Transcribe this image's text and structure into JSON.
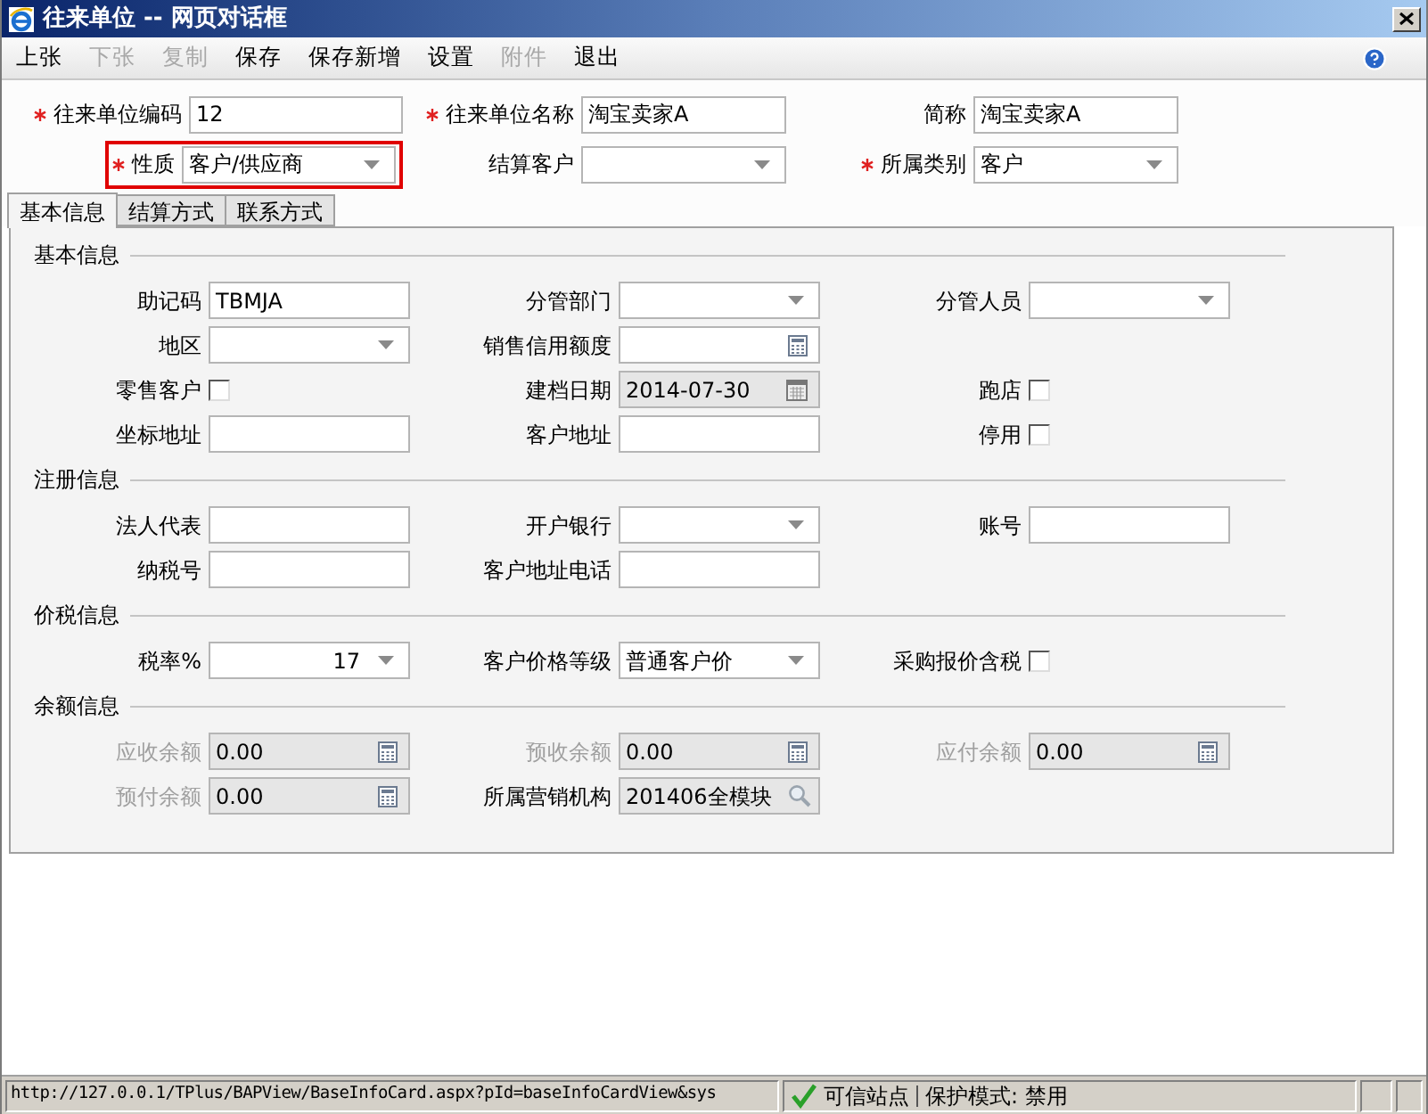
{
  "window": {
    "title": "往来单位 -- 网页对话框"
  },
  "menu": [
    {
      "label": "上张",
      "disabled": false
    },
    {
      "label": "下张",
      "disabled": true
    },
    {
      "label": "复制",
      "disabled": true
    },
    {
      "label": "保存",
      "disabled": false
    },
    {
      "label": "保存新增",
      "disabled": false
    },
    {
      "label": "设置",
      "disabled": false
    },
    {
      "label": "附件",
      "disabled": true
    },
    {
      "label": "退出",
      "disabled": false
    }
  ],
  "header": {
    "rows": [
      [
        {
          "label": "往来单位编码",
          "kind": "text",
          "value": "12",
          "required": true,
          "highlighted": false
        },
        {
          "label": "往来单位名称",
          "kind": "text",
          "value": "淘宝卖家A",
          "required": true,
          "highlighted": false
        },
        {
          "label": "简称",
          "kind": "text",
          "value": "淘宝卖家A",
          "required": false,
          "highlighted": false
        }
      ],
      [
        {
          "label": "性质",
          "kind": "dropdown",
          "value": "客户/供应商",
          "required": true,
          "highlighted": true
        },
        {
          "label": "结算客户",
          "kind": "dropdown",
          "required": false,
          "highlighted": false
        },
        {
          "label": "所属类别",
          "kind": "dropdown",
          "value": "客户",
          "required": true,
          "highlighted": false
        }
      ]
    ]
  },
  "tabs": [
    {
      "label": "基本信息",
      "selected": true
    },
    {
      "label": "结算方式",
      "selected": false
    },
    {
      "label": "联系方式",
      "selected": false
    }
  ],
  "sections": [
    {
      "title": "基本信息",
      "rows": [
        [
          {
            "label": "助记码",
            "kind": "text",
            "value": "TBMJA"
          },
          {
            "label": "分管部门",
            "kind": "dropdown"
          },
          {
            "label": "分管人员",
            "kind": "dropdown"
          }
        ],
        [
          {
            "label": "地区",
            "kind": "dropdown"
          },
          {
            "label": "销售信用额度",
            "kind": "calculator"
          }
        ],
        [
          {
            "label": "零售客户",
            "kind": "checkbox",
            "checked": false
          },
          {
            "label": "建档日期",
            "kind": "date",
            "value": "2014-07-30",
            "readonly": true
          },
          {
            "label": "跑店",
            "kind": "checkbox",
            "checked": false
          }
        ],
        [
          {
            "label": "坐标地址",
            "kind": "text"
          },
          {
            "label": "客户地址",
            "kind": "text"
          },
          {
            "label": "停用",
            "kind": "checkbox",
            "checked": false
          }
        ]
      ]
    },
    {
      "title": "注册信息",
      "rows": [
        [
          {
            "label": "法人代表",
            "kind": "text"
          },
          {
            "label": "开户银行",
            "kind": "dropdown"
          },
          {
            "label": "账号",
            "kind": "text"
          }
        ],
        [
          {
            "label": "纳税号",
            "kind": "text"
          },
          {
            "label": "客户地址电话",
            "kind": "text"
          }
        ]
      ]
    },
    {
      "title": "价税信息",
      "rows": [
        [
          {
            "label": "税率%",
            "kind": "rate",
            "value": "17"
          },
          {
            "label": "客户价格等级",
            "kind": "dropdown",
            "value": "普通客户价"
          },
          {
            "label": "采购报价含税",
            "kind": "checkbox",
            "checked": false
          }
        ]
      ]
    },
    {
      "title": "余额信息",
      "rows": [
        [
          {
            "label": "应收余额",
            "kind": "calculator",
            "value": "0.00",
            "readonly": true,
            "disabled": true
          },
          {
            "label": "预收余额",
            "kind": "calculator",
            "value": "0.00",
            "readonly": true,
            "disabled": true
          },
          {
            "label": "应付余额",
            "kind": "calculator",
            "value": "0.00",
            "readonly": true,
            "disabled": true
          }
        ],
        [
          {
            "label": "预付余额",
            "kind": "calculator",
            "value": "0.00",
            "readonly": true,
            "disabled": true
          },
          {
            "label": "所属营销机构",
            "kind": "lookup",
            "value": "201406全模块",
            "readonly": true
          }
        ]
      ]
    }
  ],
  "status_bar": {
    "url": "http://127.0.0.1/TPlus/BAPView/BaseInfoCard.aspx?pId=baseInfoCardView&sys",
    "zone": "可信站点",
    "protected_mode": "保护模式: 禁用"
  }
}
